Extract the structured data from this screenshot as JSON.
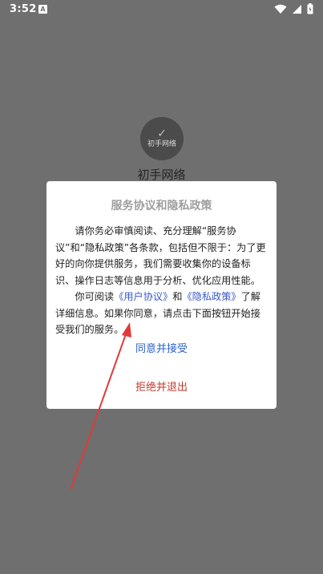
{
  "status_bar": {
    "time": "3:52",
    "notification_letter": "A",
    "icons": [
      "wifi-icon",
      "signal-icon",
      "battery-icon"
    ]
  },
  "app": {
    "logo_text": "初手网络",
    "name": "初手网络"
  },
  "dialog": {
    "title": "服务协议和隐私政策",
    "paragraph1": "请你务必审慎阅读、充分理解“服务协议”和“隐私政策”各条款，包括但不限于：为了更好的向你提供服务，我们需要收集你的设备标识、操作日志等信息用于分析、优化应用性能。",
    "paragraph2_prefix": "你可阅读",
    "user_agreement_link": "《用户协议》",
    "paragraph2_and": "和",
    "privacy_policy_link": "《隐私政策》",
    "paragraph2_suffix": "了解详细信息。如果你同意，请点击下面按钮开始接受我们的服务。",
    "agree_label": "同意并接受",
    "reject_label": "拒绝并退出"
  },
  "colors": {
    "background": "#6f6f6f",
    "accent_link": "#3a58c9",
    "agree": "#2d62c7",
    "reject": "#c0392b",
    "annotation_arrow": "#e03a3a"
  }
}
